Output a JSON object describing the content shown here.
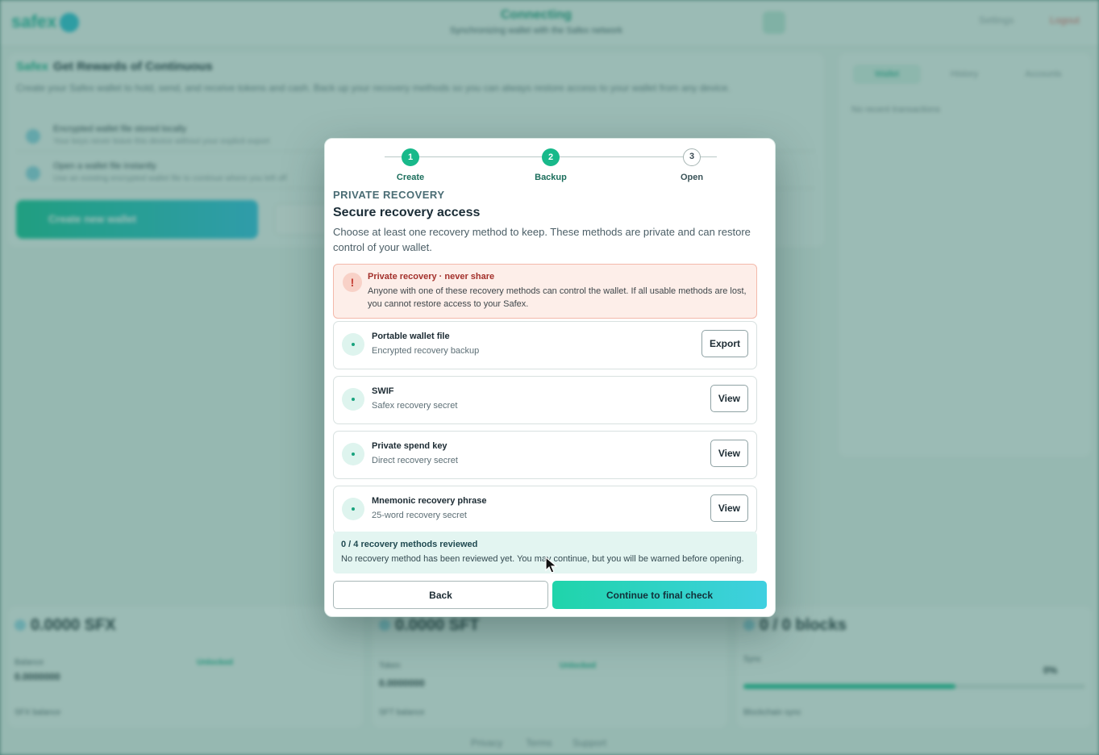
{
  "background": {
    "logo": "safex",
    "status_title": "Connecting",
    "status_sub": "Synchronizing wallet with the Safex network",
    "header_buttons": [
      "Settings",
      "Logout"
    ],
    "main_title_accent": "Safex",
    "main_title": "Get Rewards of Continuous",
    "main_desc": "Create your Safex wallet to hold, send, and receive tokens and cash. Back up your recovery methods so you can always restore access to your wallet from any device.",
    "rows": [
      {
        "title": "Encrypted wallet file stored locally",
        "sub": "Your keys never leave this device without your explicit export"
      },
      {
        "title": "Open a wallet file instantly",
        "sub": "Use an existing encrypted wallet file to continue where you left off"
      }
    ],
    "cta_label": "Create new wallet",
    "side_tabs": [
      "Wallet",
      "History",
      "Accounts"
    ],
    "side_text": "No recent transactions",
    "cards": [
      {
        "amount": "0.0000 SFX",
        "label": "Balance",
        "value": "0.0000000",
        "pill": "Unlocked",
        "foot": "SFX balance"
      },
      {
        "amount": "0.0000 SFT",
        "label": "Token",
        "value": "0.0000000",
        "pill": "Unlocked",
        "foot": "SFT balance"
      },
      {
        "amount": "0 / 0 blocks",
        "label": "Sync",
        "value": "0%",
        "pill": "",
        "foot": "Blockchain sync",
        "progress": 0.62
      }
    ],
    "footer_links": [
      "Privacy",
      "Terms",
      "Support"
    ]
  },
  "modal": {
    "steps": [
      {
        "number": "1",
        "label": "Create",
        "state": "done"
      },
      {
        "number": "2",
        "label": "Backup",
        "state": "done"
      },
      {
        "number": "3",
        "label": "Open",
        "state": "todo"
      }
    ],
    "eyebrow": "PRIVATE RECOVERY",
    "title": "Secure recovery access",
    "description": "Choose at least one recovery method to keep. These methods are private and can restore control of your wallet.",
    "warning": {
      "icon": "!",
      "title": "Private recovery · never share",
      "text": "Anyone with one of these recovery methods can control the wallet. If all usable methods are lost, you cannot restore access to your Safex."
    },
    "methods": [
      {
        "title": "Portable wallet file",
        "subtitle": "Encrypted recovery backup",
        "action": "Export"
      },
      {
        "title": "SWIF",
        "subtitle": "Safex recovery secret",
        "action": "View"
      },
      {
        "title": "Private spend key",
        "subtitle": "Direct recovery secret",
        "action": "View"
      },
      {
        "title": "Mnemonic recovery phrase",
        "subtitle": "25-word recovery secret",
        "action": "View"
      }
    ],
    "summary": {
      "title": "0 / 4 recovery methods reviewed",
      "text": "No recovery method has been reviewed yet. You may continue, but you will be warned before opening."
    },
    "back_label": "Back",
    "continue_label": "Continue to final check"
  },
  "colors": {
    "accent": "#18b98a",
    "gradient_start": "#1fd4aa",
    "gradient_end": "#3fd0e0",
    "warning_bg": "#fdeee9",
    "warning_text": "#a3302b"
  }
}
